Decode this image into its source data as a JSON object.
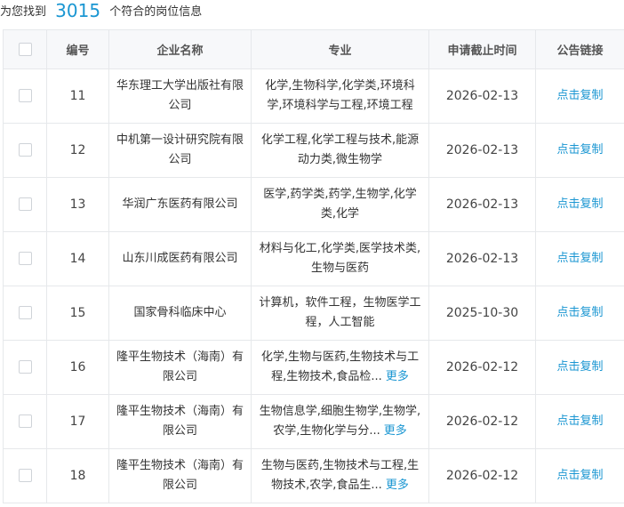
{
  "summary": {
    "prefix": "为您找到",
    "count": "3015",
    "suffix": "个符合的岗位信息"
  },
  "table": {
    "headers": {
      "id": "编号",
      "company": "企业名称",
      "major": "专业",
      "deadline": "申请截止时间",
      "link": "公告链接"
    },
    "rows": [
      {
        "id": "11",
        "company": "华东理工大学出版社有限公司",
        "major": "化学,生物科学,化学类,环境科学,环境科学与工程,环境工程",
        "more": "",
        "deadline": "2026-02-13",
        "link": "点击复制"
      },
      {
        "id": "12",
        "company": "中机第一设计研究院有限公司",
        "major": "化学工程,化学工程与技术,能源动力类,微生物学",
        "more": "",
        "deadline": "2026-02-13",
        "link": "点击复制"
      },
      {
        "id": "13",
        "company": "华润广东医药有限公司",
        "major": "医学,药学类,药学,生物学,化学类,化学",
        "more": "",
        "deadline": "2026-02-13",
        "link": "点击复制"
      },
      {
        "id": "14",
        "company": "山东川成医药有限公司",
        "major": "材料与化工,化学类,医学技术类,生物与医药",
        "more": "",
        "deadline": "2026-02-13",
        "link": "点击复制"
      },
      {
        "id": "15",
        "company": "国家骨科临床中心",
        "major": "计算机，软件工程，生物医学工程，人工智能",
        "more": "",
        "deadline": "2025-10-30",
        "link": "点击复制"
      },
      {
        "id": "16",
        "company": "隆平生物技术（海南）有限公司",
        "major": "化学,生物与医药,生物技术与工程,生物技术,食品检...",
        "more": "更多",
        "deadline": "2026-02-12",
        "link": "点击复制"
      },
      {
        "id": "17",
        "company": "隆平生物技术（海南）有限公司",
        "major": "生物信息学,细胞生物学,生物学,农学,生物化学与分...",
        "more": "更多",
        "deadline": "2026-02-12",
        "link": "点击复制"
      },
      {
        "id": "18",
        "company": "隆平生物技术（海南）有限公司",
        "major": "生物与医药,生物技术与工程,生物技术,农学,食品生...",
        "more": "更多",
        "deadline": "2026-02-12",
        "link": "点击复制"
      }
    ]
  }
}
